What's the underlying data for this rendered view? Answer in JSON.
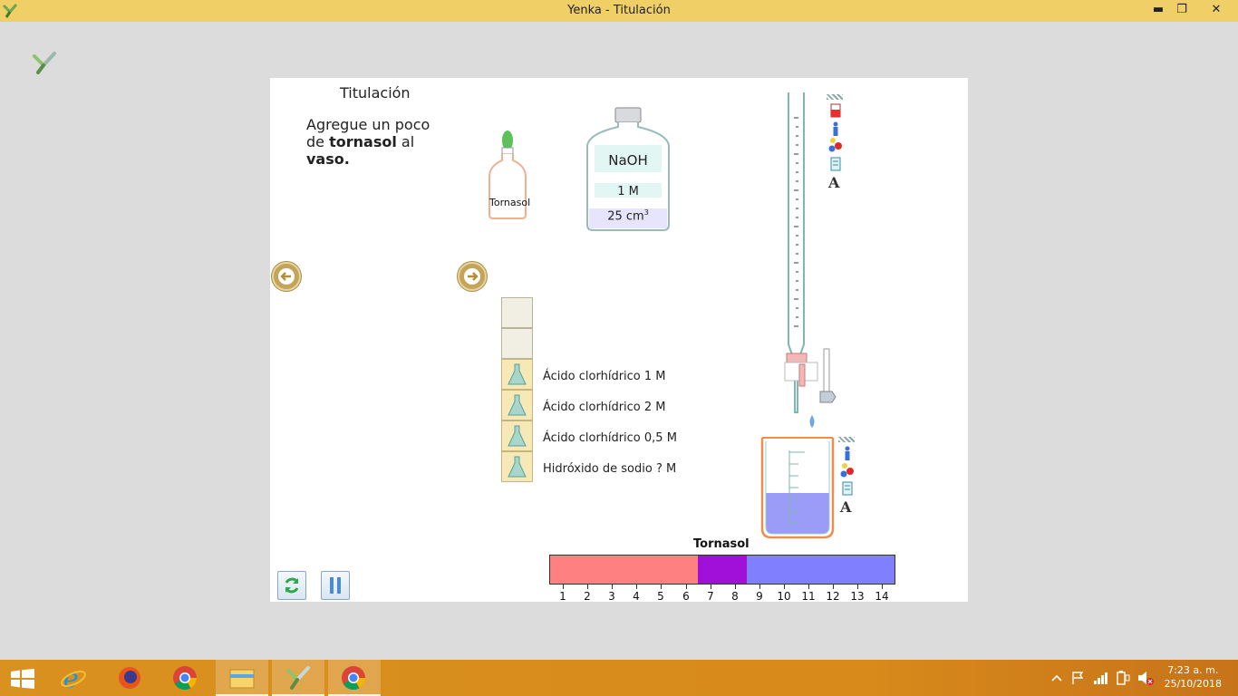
{
  "window": {
    "title": "Yenka - Titulación",
    "minimize": "▬",
    "restore": "❐",
    "close": "✕"
  },
  "lesson": {
    "heading": "Titulación",
    "instruction_part1": "Agregue un poco de ",
    "instruction_bold1": "tornasol",
    "instruction_part2": " al ",
    "instruction_bold2": "vaso."
  },
  "indicator_bottle": {
    "label": "Tornasol"
  },
  "reagent_bottle": {
    "name": "NaOH",
    "concentration": "1 M",
    "volume": "25 cm",
    "volume_sup": "3"
  },
  "reagents": [
    {
      "label": "Ácido clorhídrico 1 M"
    },
    {
      "label": "Ácido clorhídrico 2 M"
    },
    {
      "label": "Ácido clorhídrico 0,5 M"
    },
    {
      "label": "Hidróxido  de sodio ? M"
    }
  ],
  "ph_scale": {
    "title": "Tornasol",
    "numbers": [
      "1",
      "2",
      "3",
      "4",
      "5",
      "6",
      "7",
      "8",
      "9",
      "10",
      "11",
      "12",
      "13",
      "14"
    ],
    "colors": {
      "acid": "#ff8080",
      "neutral": "#a010d8",
      "base": "#8080ff"
    }
  },
  "tools_icon_letter": "A",
  "taskbar": {
    "time": "7:23 a. m.",
    "date": "25/10/2018"
  }
}
